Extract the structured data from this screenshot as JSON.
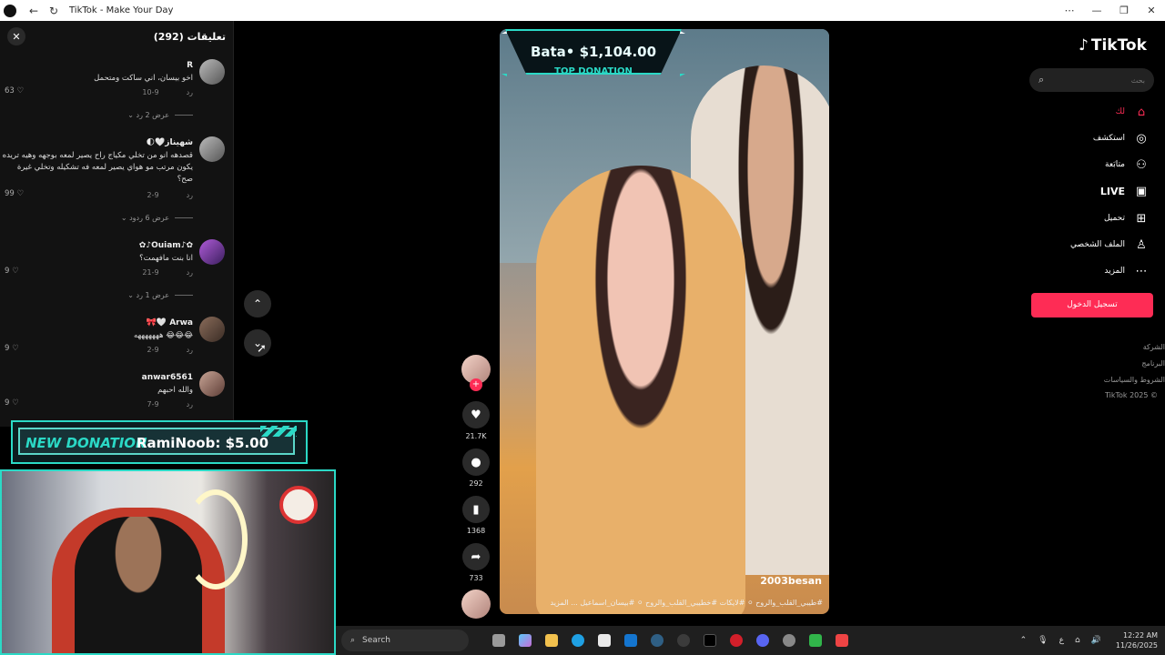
{
  "window": {
    "title": "TikTok - Make Your Day",
    "controls": [
      "⋯",
      "—",
      "❐",
      "✕"
    ]
  },
  "comments_panel": {
    "title": "تعليقات (292)",
    "items": [
      {
        "user": "R",
        "text": "اخو بيسان، اني ساكت ومتحمل",
        "date": "9-10",
        "reply": "رد",
        "likes": "63",
        "replies_label": "عرض 2 رد"
      },
      {
        "user": "شهيناز🤍🌓",
        "text": "قصدهه انو من تخلي مكياج راح يصير لمعه بوجهه وهيه تريده يكون مرتب مو هواي يصير لمعه فه تشكيله وتخلي غيرة صح؟",
        "date": "9-2",
        "reply": "رد",
        "likes": "99",
        "replies_label": "عرض 6 ردود"
      },
      {
        "user": "✿♪Ouiam♪✿",
        "text": "انا بنت مافهمت؟",
        "date": "9-21",
        "reply": "رد",
        "likes": "9",
        "replies_label": "عرض 1 رد"
      },
      {
        "user": "Arwa 🤍🎀",
        "text": "😂😂😂 هههههههه",
        "date": "9-2",
        "reply": "رد",
        "likes": "9",
        "replies_label": ""
      },
      {
        "user": "anwar6561",
        "text": "والله احبهم",
        "date": "9-7",
        "reply": "رد",
        "likes": "9",
        "replies_label": ""
      }
    ]
  },
  "nav": {
    "up_icon": "chevron-up-icon",
    "down_icon": "chevron-down-icon"
  },
  "video": {
    "handle": "2003besan",
    "caption": "#طيبي_القلب_والروح ⚪ #لايكات #خطيبي_القلب_والروح ⚪ #بيسان_اسماعيل ... المزيد"
  },
  "top_donation": {
    "amount": "Bata• $1,104.00",
    "label": "TOP DONATION"
  },
  "actions": {
    "likes": "21.7K",
    "comments": "292",
    "saves": "1368",
    "shares": "733"
  },
  "sidebar": {
    "brand": "TikTok",
    "search_placeholder": "بحث",
    "menu": [
      {
        "label": "لك",
        "icon": "home-icon"
      },
      {
        "label": "استكشف",
        "icon": "compass-icon"
      },
      {
        "label": "متابَعة",
        "icon": "follow-icon"
      },
      {
        "label": "LIVE",
        "icon": "live-icon"
      },
      {
        "label": "تحميل",
        "icon": "upload-icon"
      },
      {
        "label": "الملف الشخصي",
        "icon": "profile-icon"
      },
      {
        "label": "المزيد",
        "icon": "more-icon"
      }
    ],
    "login": "تسجيل الدخول",
    "footer": [
      "الشركة",
      "البرنامج",
      "الشروط والسياسات",
      "© 2025 TikTok"
    ]
  },
  "donation_alert": {
    "label": "NEW DONATION",
    "donor": "RamiNoob: $5.00"
  },
  "taskbar": {
    "search": "Search",
    "clock_time": "12:22 AM",
    "clock_date": "11/26/2025",
    "tray_lang": "ع"
  },
  "colors": {
    "accent": "#fe2c55",
    "overlay": "#2bd9c6"
  }
}
